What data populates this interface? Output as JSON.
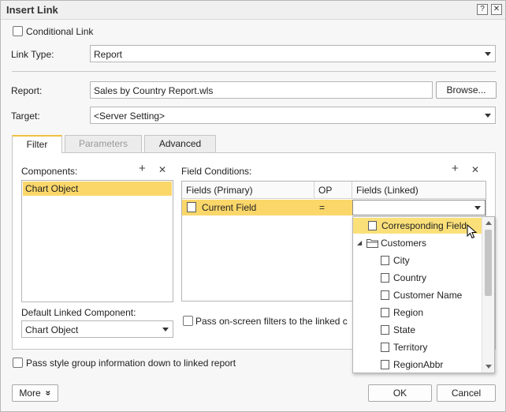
{
  "window": {
    "title": "Insert Link",
    "help_glyph": "?",
    "close_glyph": "✕"
  },
  "conditional_link": {
    "label": "Conditional Link",
    "checked": false
  },
  "link_type": {
    "label": "Link Type:",
    "value": "Report"
  },
  "report": {
    "label": "Report:",
    "value": "Sales by Country Report.wls",
    "browse_label": "Browse..."
  },
  "target": {
    "label": "Target:",
    "value": "<Server Setting>"
  },
  "tabs": [
    {
      "label": "Filter",
      "state": "active"
    },
    {
      "label": "Parameters",
      "state": "disabled"
    },
    {
      "label": "Advanced",
      "state": "normal"
    }
  ],
  "components": {
    "label": "Components:",
    "add_glyph": "+",
    "remove_glyph": "✕",
    "items": [
      "Chart Object"
    ]
  },
  "field_conditions": {
    "label": "Field Conditions:",
    "add_glyph": "+",
    "remove_glyph": "✕",
    "columns": [
      "Fields (Primary)",
      "OP",
      "Fields (Linked)"
    ],
    "rows": [
      {
        "primary": "Current Field",
        "op": "=",
        "linked": ""
      }
    ]
  },
  "default_linked_component": {
    "label": "Default Linked Component:",
    "value": "Chart Object"
  },
  "pass_filters": {
    "label": "Pass on-screen filters to the linked c",
    "checked": false
  },
  "linked_dropdown": {
    "highlighted": "Corresponding Field",
    "group": "Customers",
    "group_expander": "◢",
    "children": [
      "City",
      "Country",
      "Customer Name",
      "Region",
      "State",
      "Territory",
      "RegionAbbr"
    ]
  },
  "pass_style": {
    "label": "Pass style group information down to linked report",
    "checked": false
  },
  "footer": {
    "more_label": "More",
    "more_glyph": "»",
    "ok_label": "OK",
    "cancel_label": "Cancel"
  },
  "colors": {
    "selection": "#fbd76a",
    "tab_accent": "#f0c040",
    "highlight_row": "#fbe07a"
  }
}
